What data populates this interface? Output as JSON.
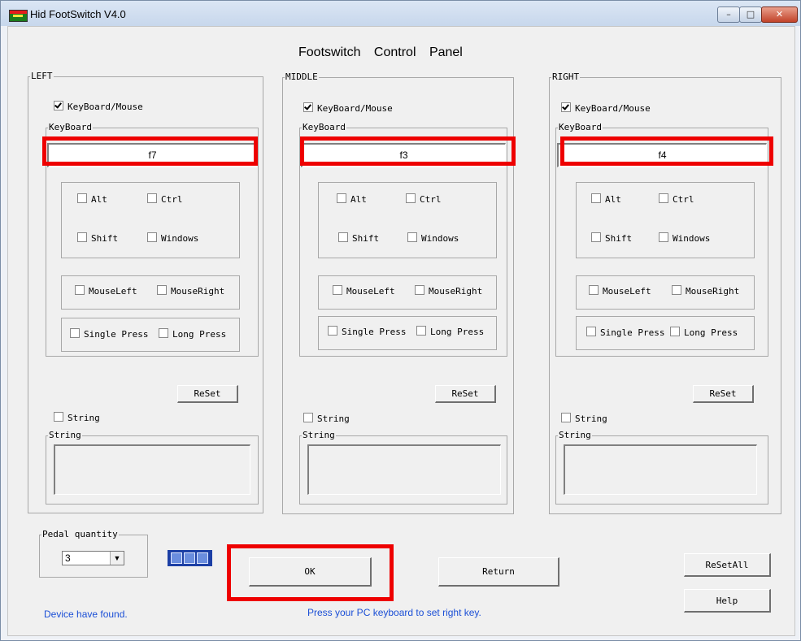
{
  "window": {
    "title": "Hid FootSwitch V4.0",
    "min_glyph": "–",
    "max_glyph": "□",
    "close_glyph": "✕"
  },
  "heading": "Footswitch Control Panel",
  "panels": [
    {
      "legend": "LEFT",
      "keyboard_mouse": {
        "label": "KeyBoard/Mouse",
        "checked": true
      },
      "keyboard_legend": "KeyBoard",
      "key": "f7",
      "alt": "Alt",
      "ctrl": "Ctrl",
      "shift": "Shift",
      "windows": "Windows",
      "mouse_left": "MouseLeft",
      "mouse_right": "MouseRight",
      "single_press": "Single Press",
      "long_press": "Long Press",
      "reset": "ReSet",
      "string_check": "String",
      "string_legend": "String"
    },
    {
      "legend": "MIDDLE",
      "keyboard_mouse": {
        "label": "KeyBoard/Mouse",
        "checked": true
      },
      "keyboard_legend": "KeyBoard",
      "key": "f3",
      "alt": "Alt",
      "ctrl": "Ctrl",
      "shift": "Shift",
      "windows": "Windows",
      "mouse_left": "MouseLeft",
      "mouse_right": "MouseRight",
      "single_press": "Single Press",
      "long_press": "Long Press",
      "reset": "ReSet",
      "string_check": "String",
      "string_legend": "String"
    },
    {
      "legend": "RIGHT",
      "keyboard_mouse": {
        "label": "KeyBoard/Mouse",
        "checked": true
      },
      "keyboard_legend": "KeyBoard",
      "key": "f4",
      "alt": "Alt",
      "ctrl": "Ctrl",
      "shift": "Shift",
      "windows": "Windows",
      "mouse_left": "MouseLeft",
      "mouse_right": "MouseRight",
      "single_press": "Single Press",
      "long_press": "Long Press",
      "reset": "ReSet",
      "string_check": "String",
      "string_legend": "String"
    }
  ],
  "pedal_quantity": {
    "legend": "Pedal quantity",
    "value": "3",
    "arrow": "▼"
  },
  "buttons": {
    "ok": "OK",
    "return": "Return",
    "reset_all": "ReSetAll",
    "help": "Help"
  },
  "status": {
    "device": "Device have found.",
    "hint": "Press your PC keyboard to set right key."
  },
  "colors": {
    "highlight": "#ee0000",
    "status_text": "#1b4fd6"
  }
}
